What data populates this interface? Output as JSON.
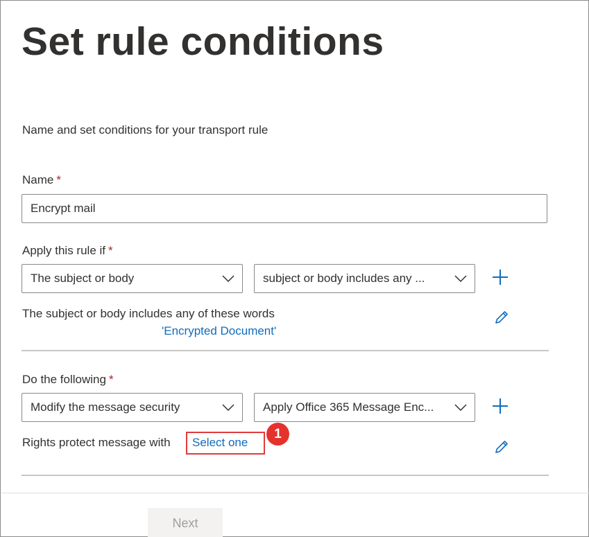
{
  "header": {
    "title": "Set rule conditions"
  },
  "intro": {
    "text": "Name and set conditions for your transport rule"
  },
  "name_section": {
    "label": "Name",
    "required_mark": "*",
    "value": "Encrypt mail"
  },
  "apply_section": {
    "label": "Apply this rule if",
    "required_mark": "*",
    "dropdown_1": "The subject or body",
    "dropdown_2": "subject or body includes any ...",
    "condition_text": "The subject or body includes any of these words",
    "condition_value": "'Encrypted Document'"
  },
  "action_section": {
    "label": "Do the following",
    "required_mark": "*",
    "dropdown_1": "Modify the message security",
    "dropdown_2": "Apply Office 365 Message Enc...",
    "action_text": "Rights protect message with",
    "action_link": "Select one"
  },
  "callout": {
    "number": "1",
    "color": "#e5322d"
  },
  "footer": {
    "next_label": "Next"
  },
  "icons": {
    "chevron": "chevron-down-icon",
    "add": "plus-icon",
    "edit": "pencil-icon"
  },
  "colors": {
    "accent": "#0f6cbd",
    "required": "#a4262c",
    "highlight": "#e03a3a"
  }
}
